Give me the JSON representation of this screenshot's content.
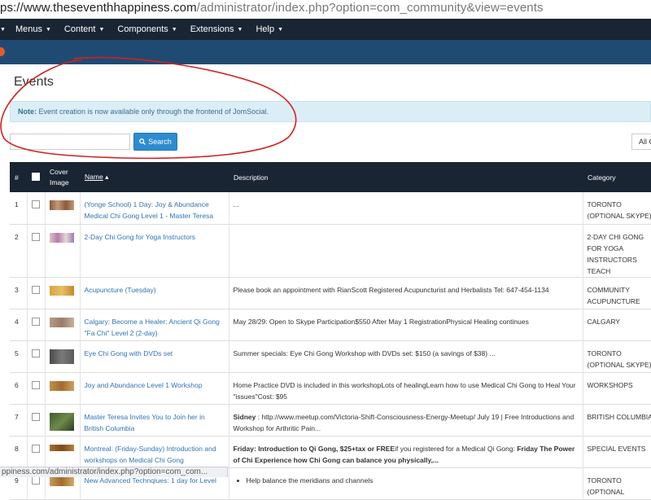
{
  "browser": {
    "url_prefix": "ps://www.theseventhhappiness.com",
    "url_path": "/administrator/index.php?option=com_community&view=events",
    "status_url": "ppiness.com/administrator/index.php?option=com_com..."
  },
  "menu": {
    "items": [
      {
        "label": "Menus"
      },
      {
        "label": "Content"
      },
      {
        "label": "Components"
      },
      {
        "label": "Extensions"
      },
      {
        "label": "Help"
      }
    ]
  },
  "page": {
    "title": "Events",
    "note_label": "Note:",
    "note_text": " Event creation is now available only through the frontend of JomSocial.",
    "search_placeholder": "",
    "search_button": "Search",
    "filter_value": "All C"
  },
  "table": {
    "headers": {
      "num": "#",
      "cover": "Cover Image",
      "name": "Name",
      "description": "Description",
      "category": "Category"
    },
    "rows": [
      {
        "num": "1",
        "name": "(Yonge School) 1 Day: Joy & Abundance Medical Chi Gong Level 1 - Master Teresa",
        "description": "...",
        "category": "TORONTO (OPTIONAL SKYPE)",
        "thumb": [
          "#8b5a3c",
          "#c49a72"
        ]
      },
      {
        "num": "2",
        "name": "2-Day Chi Gong for Yoga Instructors",
        "description": "",
        "category": "2-DAY CHI GONG FOR YOGA INSTRUCTORS TEACH",
        "thumb": [
          "#d9c7c0",
          "#b47bb0"
        ]
      },
      {
        "num": "3",
        "name": "Acupuncture (Tuesday)",
        "description": "Please book an appointment with RianScott Registered  Acupuncturist and Herbalists  Tel: 647-454-1134",
        "category": "COMMUNITY ACUPUNCTURE",
        "thumb": [
          "#d8a33a",
          "#e6c06a"
        ]
      },
      {
        "num": "4",
        "name": "Calgary: Become a Healer: Ancient Qi Gong \"Fa Chi\" Level 2 (2-day)",
        "description": "May 28/29: Open to Skype Participation$550 After May 1 RegistrationPhysical Healing continues",
        "category": "CALGARY",
        "thumb": [
          "#b89a88",
          "#9c7a68"
        ]
      },
      {
        "num": "5",
        "name": "Eye Chi Gong with DVDs set",
        "description": "Summer specials: Eye Chi Gong Workshop with DVDs set: $150  (a savings of $38) ...",
        "category": "TORONTO (OPTIONAL SKYPE)",
        "thumb": [
          "#4a4a4a",
          "#7a7a7a"
        ]
      },
      {
        "num": "6",
        "name": "Joy and Abundance Level 1 Workshop",
        "description": "Home Practice DVD is included in this workshopLots of healingLearn how to use Medical Chi Gong to Heal Your \"issues\"Cost: $95",
        "category": "WORKSHOPS",
        "thumb": [
          "#c0904c",
          "#a46b2a"
        ]
      },
      {
        "num": "7",
        "name": "Master Teresa Invites You to Join her in British Columbia",
        "description_bold": "Sidney",
        "description": " : http://www.meetup.com/Victoria-Shift-Consciousness-Energy-Meetup/ July 19 | Free Introductions and Workshop for Arthritic Pain...",
        "category": "BRITISH COLUMBIA",
        "thumb": [
          "#3f5a2e",
          "#6d8a4a"
        ]
      },
      {
        "num": "8",
        "name": "Montreal: (Friday-Sunday) Introduction and workshops on Medical Chi Gong",
        "description_bold": "Friday: Introduction to Qi Gong, $25+tax or FREE",
        "description": "if you registered for a Medical Qi Gong: ",
        "description_bold2": "Friday The Power of Chi Experience how Chi Gong can balance you physically,...",
        "category": "SPECIAL EVENTS",
        "thumb": [
          "#a8702e",
          "#7a4a1a"
        ]
      },
      {
        "num": "9",
        "name": "New Advanced Technqiues: 1 day for Level",
        "description_bullet": "Help balance the meridians and channels",
        "category": "TORONTO (OPTIONAL",
        "thumb": [
          "#c89a5a",
          "#a06a2a"
        ]
      }
    ]
  },
  "colors": {
    "menubar": "#1a2534",
    "subbar": "#1f4b73",
    "link": "#2f74b5",
    "note_bg": "#dbeef6",
    "button": "#2d8ccf",
    "annotation": "#d42020"
  }
}
